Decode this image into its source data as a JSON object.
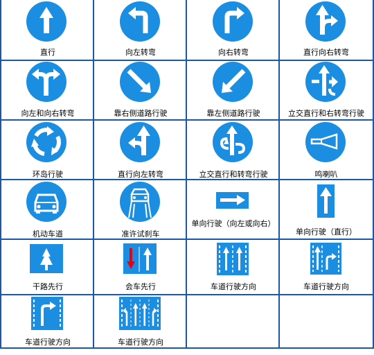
{
  "signs": [
    {
      "label": "直行",
      "icon": "straight-arrow-icon"
    },
    {
      "label": "向左转弯",
      "icon": "turn-left-icon"
    },
    {
      "label": "向右转弯",
      "icon": "turn-right-icon"
    },
    {
      "label": "直行向右转弯",
      "icon": "straight-or-right-icon"
    },
    {
      "label": "向左和向右转弯",
      "icon": "left-or-right-icon"
    },
    {
      "label": "靠右侧道路行驶",
      "icon": "keep-right-icon"
    },
    {
      "label": "靠左侧道路行驶",
      "icon": "keep-left-icon"
    },
    {
      "label": "立交直行和右转弯行驶",
      "icon": "interchange-straight-right-icon"
    },
    {
      "label": "环岛行驶",
      "icon": "roundabout-icon"
    },
    {
      "label": "直行向左转弯",
      "icon": "straight-or-left-icon"
    },
    {
      "label": "立交直行和转弯行驶",
      "icon": "interchange-straight-turn-icon"
    },
    {
      "label": "鸣喇叭",
      "icon": "horn-icon"
    },
    {
      "label": "机动车道",
      "icon": "motor-vehicle-lane-icon"
    },
    {
      "label": "准许试刹车",
      "icon": "brake-test-icon"
    },
    {
      "label": "单向行驶（向左或向右）",
      "icon": "one-way-horizontal-icon"
    },
    {
      "label": "单向行驶（直行）",
      "icon": "one-way-straight-icon"
    },
    {
      "label": "干路先行",
      "icon": "main-road-priority-icon"
    },
    {
      "label": "会车先行",
      "icon": "oncoming-priority-icon"
    },
    {
      "label": "车道行驶方向",
      "icon": "lane-direction-two-straight-icon"
    },
    {
      "label": "车道行驶方向",
      "icon": "lane-direction-straight-right-icon"
    },
    {
      "label": "车道行驶方向",
      "icon": "lane-direction-right-icon"
    },
    {
      "label": "车道行驶方向",
      "icon": "lane-direction-multi-icon"
    }
  ],
  "colors": {
    "sign_blue": "#1c8ee2",
    "grid_blue": "#1c56a8",
    "red": "#e60012"
  }
}
